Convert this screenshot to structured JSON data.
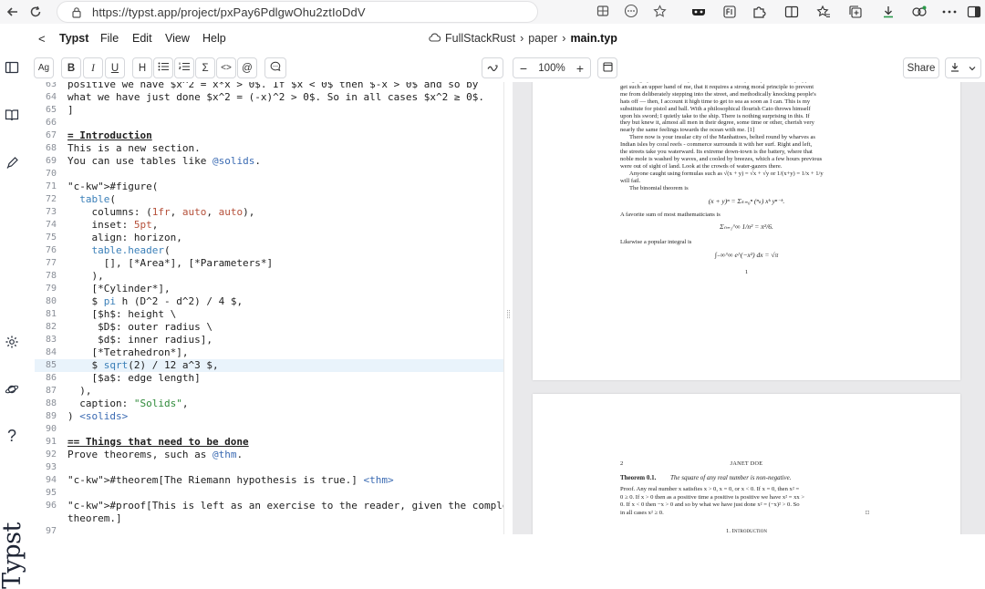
{
  "browser": {
    "url": "https://typst.app/project/pxPay6PdlgwOhu2ztIoDdV"
  },
  "menubar": {
    "back": "<",
    "app_name": "Typst",
    "items": [
      "File",
      "Edit",
      "View",
      "Help"
    ],
    "project": "FullStackRust",
    "folder": "paper",
    "file": "main.typ",
    "sep": "›"
  },
  "toolbar": {
    "style_label": "Ag",
    "bold": "B",
    "italic": "I",
    "underline": "U",
    "heading": "H",
    "math": "Σ",
    "code": "<>",
    "ref": "@",
    "zoom": "100%",
    "zoom_out": "−",
    "zoom_in": "+",
    "share": "Share",
    "download": "⤓",
    "download_more": "⌄"
  },
  "editor": {
    "lines": [
      {
        "n": "63",
        "t": "positive we have $x^2 = x*x > 0$. If $x < 0$ then $-x > 0$ and so by"
      },
      {
        "n": "64",
        "t": "what we have just done $x^2 = (-x)^2 > 0$. So in all cases $x^2 ≥ 0$."
      },
      {
        "n": "65",
        "t": "]"
      },
      {
        "n": "66",
        "t": ""
      },
      {
        "n": "67",
        "t": "= Introduction"
      },
      {
        "n": "68",
        "t": "This is a new section."
      },
      {
        "n": "69",
        "t": "You can use tables like @solids."
      },
      {
        "n": "70",
        "t": ""
      },
      {
        "n": "71",
        "t": "#figure("
      },
      {
        "n": "72",
        "t": "  table("
      },
      {
        "n": "73",
        "t": "    columns: (1fr, auto, auto),"
      },
      {
        "n": "74",
        "t": "    inset: 5pt,"
      },
      {
        "n": "75",
        "t": "    align: horizon,"
      },
      {
        "n": "76",
        "t": "    table.header("
      },
      {
        "n": "77",
        "t": "      [], [*Area*], [*Parameters*]"
      },
      {
        "n": "78",
        "t": "    ),"
      },
      {
        "n": "79",
        "t": "    [*Cylinder*],"
      },
      {
        "n": "80",
        "t": "    $ pi h (D^2 - d^2) / 4 $,"
      },
      {
        "n": "81",
        "t": "    [$h$: height \\"
      },
      {
        "n": "82",
        "t": "     $D$: outer radius \\"
      },
      {
        "n": "83",
        "t": "     $d$: inner radius],"
      },
      {
        "n": "84",
        "t": "    [*Tetrahedron*],"
      },
      {
        "n": "85",
        "t": "    $ sqrt(2) / 12 a^3 $,"
      },
      {
        "n": "86",
        "t": "    [$a$: edge length]"
      },
      {
        "n": "87",
        "t": "  ),"
      },
      {
        "n": "88",
        "t": "  caption: \"Solids\","
      },
      {
        "n": "89",
        "t": ") <solids>"
      },
      {
        "n": "90",
        "t": ""
      },
      {
        "n": "91",
        "t": "== Things that need to be done"
      },
      {
        "n": "92",
        "t": "Prove theorems, such as @thm."
      },
      {
        "n": "93",
        "t": ""
      },
      {
        "n": "94",
        "t": "#theorem[The Riemann hypothesis is true.] <thm>"
      },
      {
        "n": "95",
        "t": ""
      },
      {
        "n": "96",
        "t": "#proof[This is left as an exercise to the reader, given the complexity of the"
      },
      {
        "n": "",
        "t": "theorem.]"
      },
      {
        "n": "97",
        "t": ""
      }
    ]
  },
  "preview": {
    "page1": {
      "para1": [
        "changing up the rear of every funeral I meet; and especially whenever my hypos",
        "get such an upper hand of me, that it requires a strong moral principle to prevent",
        "me from deliberately stepping into the street, and methodically knocking people's",
        "hats off — then, I account it high time to get to sea as soon as I can. This is my",
        "substitute for pistol and ball. With a philosophical flourish Cato throws himself",
        "upon his sword; I quietly take to the ship. There is nothing surprising in this. If",
        "they but knew it, almost all men in their degree, some time or other, cherish very",
        "nearly the same feelings towards the ocean with me. [1]"
      ],
      "para2": [
        "There now is your insular city of the Manhattoes, belted round by wharves as",
        "Indian isles by coral reefs - commerce surrounds it with her surf. Right and left,",
        "the streets take you waterward. Its extreme down-town is the battery, where that",
        "noble mole is washed by waves, and cooled by breezes, which a few hours previous",
        "were out of sight of land. Look at the crowds of water-gazers there."
      ],
      "formula_line": "Anyone caught using formulas such as √(x + y) = √x + √y or 1/(x+y) = 1/x + 1/y",
      "will_fail": "will fail.",
      "binomial_intro": "The binomial theorem is",
      "binomial": "(x + y)ⁿ = Σₖ₌₀ⁿ (ⁿₖ) xᵏ yⁿ⁻ᵏ.",
      "sum_intro": "A favorite sum of most mathematicians is",
      "sum": "Σₙ₌₁^∞ 1/n² = π²/6.",
      "integral_intro": "Likewise a popular integral is",
      "integral": "∫₋∞^∞ e^(−x²) dx = √π",
      "page_number": "1"
    },
    "page2": {
      "page_number": "2",
      "header": "JANET DOE",
      "theorem_label": "Theorem 0.1.",
      "theorem_text": "The square of any real number is non-negative.",
      "proof_lines": [
        "Proof. Any real number x satisfies x > 0, x = 0, or x < 0. If x = 0, then x² =",
        "0 ≥ 0. If x > 0 then as a positive time a positive is positive we have x² = xx >",
        "0. If x < 0 then −x > 0 and so by what we have just done x² = (−x)² > 0. So",
        "in all cases x² ≥ 0."
      ],
      "qed": "□",
      "section": "1. Introduction"
    }
  },
  "colors": {
    "accent": "#239dad",
    "line_highlight": "#e9f3fb",
    "keyword": "#3a6ab2",
    "string": "#2f8a3a",
    "number": "#b5503a"
  }
}
